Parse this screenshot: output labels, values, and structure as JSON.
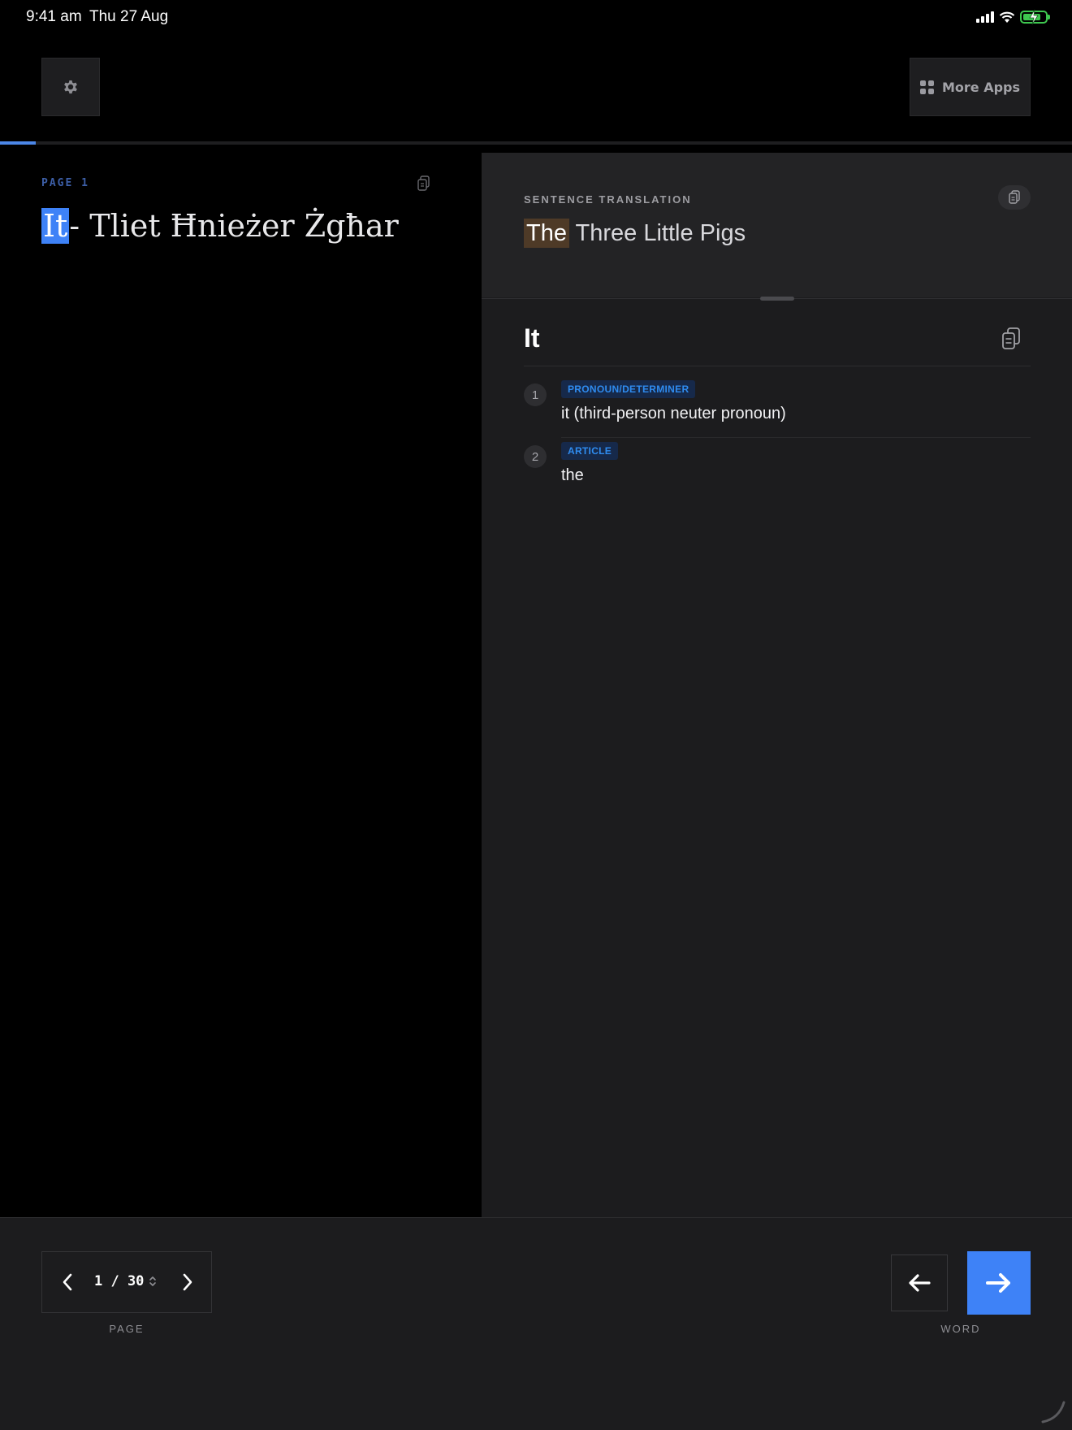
{
  "status_bar": {
    "time": "9:41 am",
    "date": "Thu 27 Aug",
    "battery_level": 0.8,
    "battery_color": "#3ec74f"
  },
  "toolbar": {
    "settings_icon": "gear-icon",
    "more_apps_label": "More Apps",
    "more_apps_icon": "grid-icon"
  },
  "reading_progress": 0.033,
  "page": {
    "label": "PAGE 1",
    "words": [
      {
        "text": "It",
        "active": true
      },
      {
        "text": "-",
        "active": false
      },
      {
        "text": "Tliet",
        "active": false
      },
      {
        "text": "Ħnieżer",
        "active": false
      },
      {
        "text": "Żgħar",
        "active": false
      }
    ]
  },
  "translation": {
    "heading": "SENTENCE TRANSLATION",
    "highlight": "The",
    "rest": "Three Little Pigs"
  },
  "word_detail": {
    "word": "It",
    "definitions": [
      {
        "number": "1",
        "tag": "PRONOUN/DETERMINER",
        "text": "it (third-person neuter pronoun)"
      },
      {
        "number": "2",
        "tag": "ARTICLE",
        "text": "the"
      }
    ]
  },
  "navigation": {
    "page_value": "1 / 30",
    "page_caption": "PAGE",
    "word_caption": "WORD"
  },
  "colors": {
    "accent": "#3e82f7",
    "translation_highlight": "#4e3a27",
    "tag_text": "#2f8cf0"
  }
}
